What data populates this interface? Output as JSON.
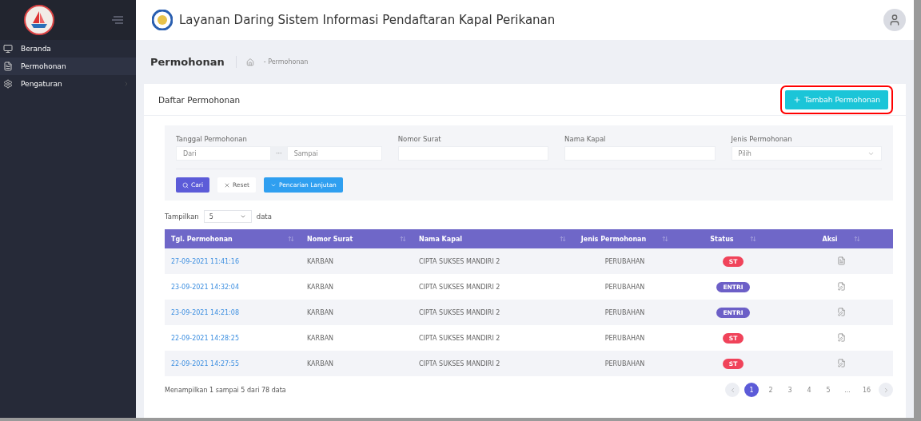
{
  "sidebar": {
    "items": [
      {
        "label": "Beranda",
        "kind": "monitor",
        "selected": false,
        "has_submenu": false
      },
      {
        "label": "Permohonan",
        "kind": "document",
        "selected": true,
        "has_submenu": false
      },
      {
        "label": "Pengaturan",
        "kind": "settings",
        "selected": false,
        "has_submenu": true
      }
    ]
  },
  "header": {
    "title": "Layanan Daring Sistem Informasi Pendaftaran Kapal Perikanan"
  },
  "subheader": {
    "title": "Permohonan",
    "breadcrumb": "- Permohonan"
  },
  "card": {
    "title": "Daftar Permohonan",
    "add_button": {
      "label": "Tambah Permohonan",
      "highlighted": true
    }
  },
  "filters": {
    "date": {
      "label": "Tanggal Permohonan",
      "from_placeholder": "Dari",
      "separator": "···",
      "to_placeholder": "Sampai"
    },
    "fields": [
      {
        "label": "Nomor Surat",
        "kind": "text"
      },
      {
        "label": "Nama Kapal",
        "kind": "text"
      },
      {
        "label": "Jenis Permohonan",
        "kind": "select",
        "placeholder": "Pilih"
      }
    ],
    "buttons": [
      {
        "label": "Cari",
        "kind": "primary"
      },
      {
        "label": "Reset",
        "kind": "plain"
      },
      {
        "label": "Pencarian Lanjutan",
        "kind": "info"
      }
    ]
  },
  "page_size": {
    "prefix": "Tampilkan",
    "value": "5",
    "suffix": "data"
  },
  "table": {
    "columns": [
      "Tgl. Permohonan",
      "Nomor Surat",
      "Nama Kapal",
      "Jenis Permohonan",
      "Status",
      "Aksi"
    ],
    "rows": [
      {
        "date": "27-09-2021 11:41:16",
        "nomor": "KARBAN",
        "kapal": "CIPTA SUKSES MANDIRI 2",
        "jenis": "PERUBAHAN",
        "status": "ST",
        "color": "#f0435a",
        "kind": "view"
      },
      {
        "date": "23-09-2021 14:32:04",
        "nomor": "KARBAN",
        "kapal": "CIPTA SUKSES MANDIRI 2",
        "jenis": "PERUBAHAN",
        "status": "ENTRI",
        "color": "#6c5fc7",
        "kind": "edit"
      },
      {
        "date": "23-09-2021 14:21:08",
        "nomor": "KARBAN",
        "kapal": "CIPTA SUKSES MANDIRI 2",
        "jenis": "PERUBAHAN",
        "status": "ENTRI",
        "color": "#6c5fc7",
        "kind": "edit"
      },
      {
        "date": "22-09-2021 14:28:25",
        "nomor": "KARBAN",
        "kapal": "CIPTA SUKSES MANDIRI 2",
        "jenis": "PERUBAHAN",
        "status": "ST",
        "color": "#f0435a",
        "kind": "edit"
      },
      {
        "date": "22-09-2021 14:27:55",
        "nomor": "KARBAN",
        "kapal": "CIPTA SUKSES MANDIRI 2",
        "jenis": "PERUBAHAN",
        "status": "ST",
        "color": "#f0435a",
        "kind": "edit"
      }
    ]
  },
  "footer": {
    "summary": "Menampilkan 1 sampai 5 dari 78 data",
    "pages": [
      {
        "label": "1",
        "selected": true
      },
      {
        "label": "2",
        "selected": false
      },
      {
        "label": "3",
        "selected": false
      },
      {
        "label": "4",
        "selected": false
      },
      {
        "label": "5",
        "selected": false
      },
      {
        "label": "...",
        "selected": false
      },
      {
        "label": "16",
        "selected": false
      }
    ]
  }
}
